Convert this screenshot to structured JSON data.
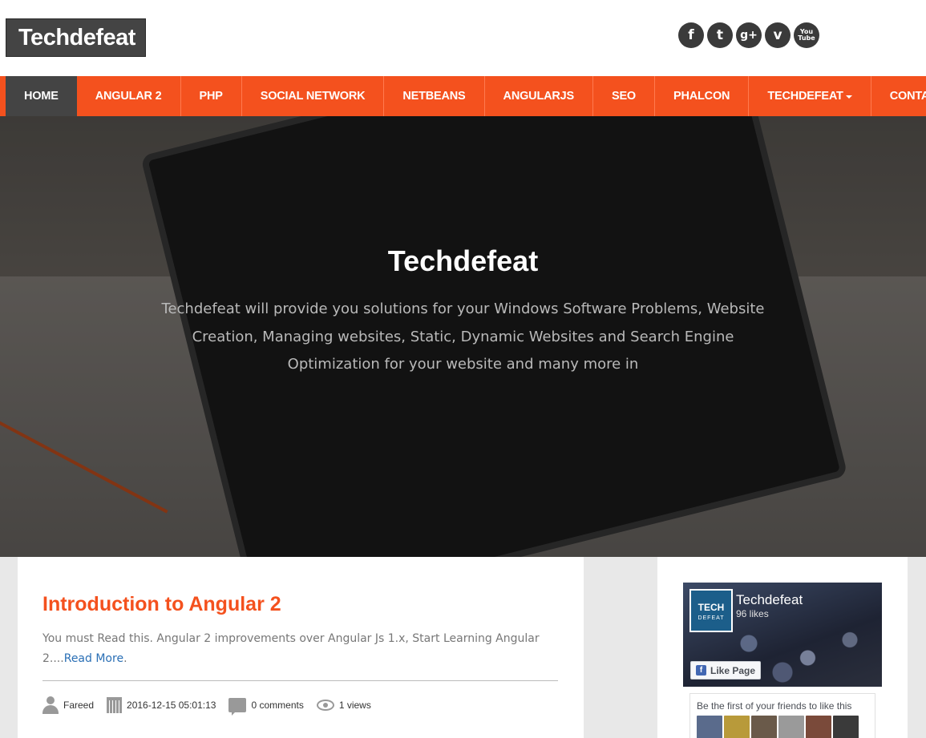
{
  "header": {
    "logo": "Techdefeat",
    "social": [
      {
        "icon": "facebook-icon",
        "glyph": "f"
      },
      {
        "icon": "twitter-icon",
        "glyph": "t"
      },
      {
        "icon": "google-plus-icon",
        "glyph": "g+"
      },
      {
        "icon": "vimeo-icon",
        "glyph": "v"
      },
      {
        "icon": "youtube-icon",
        "glyph": "You Tube"
      }
    ]
  },
  "nav": {
    "items": [
      "HOME",
      "ANGULAR 2",
      "PHP",
      "SOCIAL NETWORK",
      "NETBEANS",
      "ANGULARJS",
      "SEO",
      "PHALCON",
      "TECHDEFEAT",
      "CONTACT"
    ]
  },
  "hero": {
    "title": "Techdefeat",
    "text": "Techdefeat will provide you solutions for your Windows Software Problems, Website Creation, Managing websites, Static, Dynamic Websites and Search Engine Optimization for your website and many more in"
  },
  "post": {
    "title": "Introduction to Angular 2",
    "excerpt": "You must Read this. Angular 2 improvements over Angular Js 1.x, Start Learning Angular 2....",
    "read_more": "Read More",
    "read_more_tail": ".",
    "author": "Fareed",
    "date": "2016-12-15 05:01:13",
    "comments": "0 comments",
    "views": "1 views"
  },
  "facebook": {
    "logo_top": "TECH",
    "logo_bottom": "DEFEAT",
    "page_name": "Techdefeat",
    "likes": "96 likes",
    "like_button": "Like Page",
    "like_glyph": "f",
    "friends_text": "Be the first of your friends to like this"
  },
  "colors": {
    "accent": "#f4511e",
    "dark": "#444444",
    "link": "#2a6fb5"
  }
}
